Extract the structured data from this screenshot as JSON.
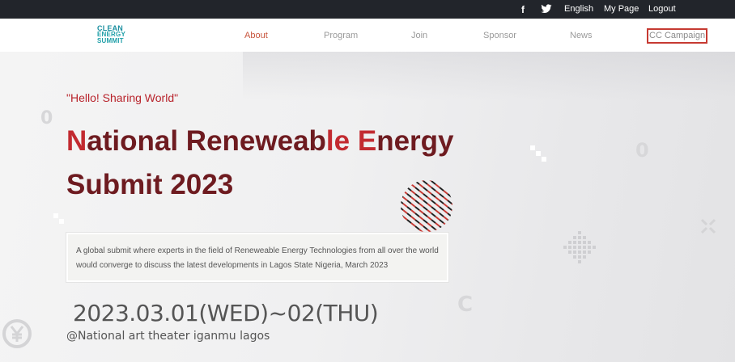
{
  "topbar": {
    "facebook_icon": "facebook-icon",
    "twitter_icon": "twitter-icon",
    "language": "English",
    "my_page": "My Page",
    "logout": "Logout"
  },
  "logo": {
    "line1": "CLEAN",
    "line2": "ENERGY",
    "line3": "SUMMIT"
  },
  "nav": {
    "items": [
      {
        "label": "About",
        "active": true
      },
      {
        "label": "Program"
      },
      {
        "label": "Join"
      },
      {
        "label": "Sponsor"
      },
      {
        "label": "News"
      }
    ],
    "cc_campaign": "CC Campaign"
  },
  "hero": {
    "tagline": "\"Hello! Sharing World\"",
    "title_line1_part1": "N",
    "title_line1_part2": "ational Reneweab",
    "title_line1_part3": "le ",
    "title_line1_part4": "E",
    "title_line1_part5": "nergy",
    "title_line2": "Submit 2023",
    "description": "A global submit where experts in the field of Reneweable Energy Technologies from all over the world would converge to discuss the latest developments in Lagos State Nigeria, March 2023",
    "date": "2023.03.01(WED)~02(THU)",
    "venue": "@National art theater iganmu lagos"
  },
  "colors": {
    "accent_red": "#c22a30",
    "title_dark": "#6e1b20",
    "topbar": "#22252b",
    "logo_teal": "#1f9fa8"
  }
}
